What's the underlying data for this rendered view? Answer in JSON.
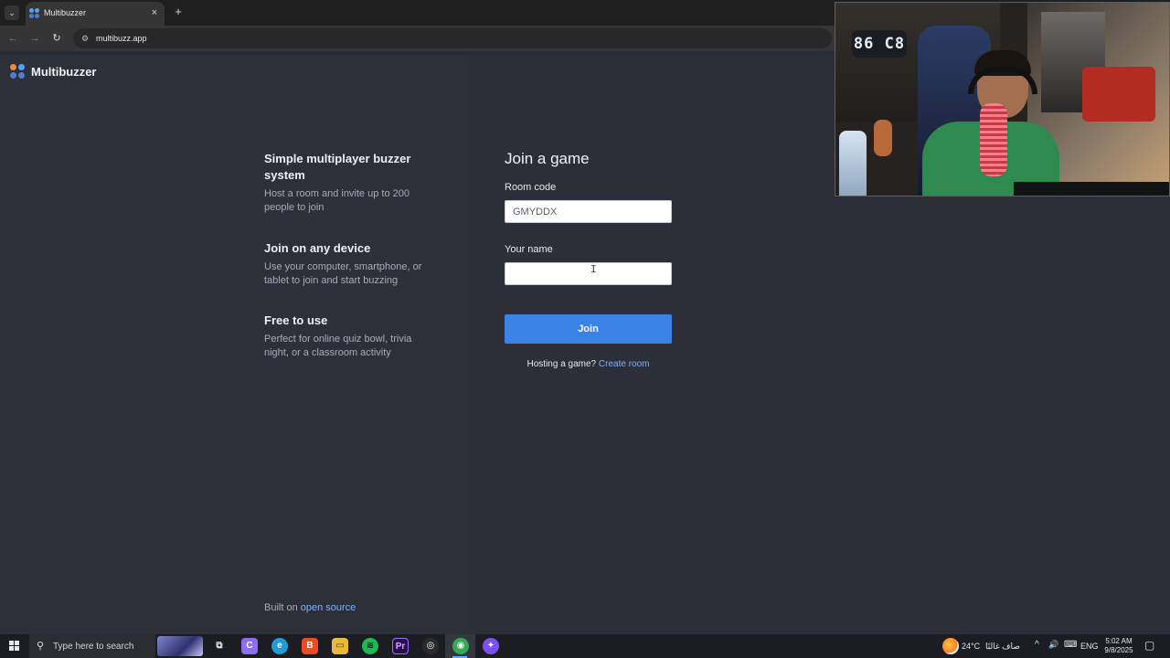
{
  "browser": {
    "tab_title": "Multibuzzer",
    "tab_close_label": "×",
    "new_tab_label": "+",
    "tab_list_label": "⌄",
    "url": "multibuzz.app",
    "back_label": "←",
    "forward_label": "→",
    "reload_label": "↻",
    "site_info_label": "⚙"
  },
  "brand": {
    "name": "Multibuzzer",
    "logo_colors": [
      "#f08c2e",
      "#5aa0f0",
      "#4c7dd9",
      "#4c7dd9"
    ]
  },
  "features": [
    {
      "title": "Simple multiplayer buzzer system",
      "description": "Host a room and invite up to 200 people to join"
    },
    {
      "title": "Join on any device",
      "description": "Use your computer, smartphone, or tablet to join and start buzzing"
    },
    {
      "title": "Free to use",
      "description": "Perfect for online quiz bowl, trivia night, or a classroom activity"
    }
  ],
  "footer": {
    "built_on_prefix": "Built on ",
    "built_on_link": "open source"
  },
  "join_form": {
    "title": "Join a game",
    "room_code_label": "Room code",
    "room_code_value": "GMYDDX",
    "name_label": "Your name",
    "name_value": "",
    "cursor_glyph": "I",
    "join_button": "Join",
    "hosting_prefix": "Hosting a game?",
    "create_room_link": "Create room"
  },
  "webcam": {
    "clock_display": "86 C8"
  },
  "taskbar": {
    "search_placeholder": "Type here to search",
    "search_icon_glyph": "⚲",
    "task_view_glyph": "⧉",
    "icons": [
      {
        "name": "copilot-icon",
        "glyph": "C",
        "color": "#8f6df0"
      },
      {
        "name": "edge-icon",
        "glyph": "e",
        "color": "#1f9bd8"
      },
      {
        "name": "brave-icon",
        "glyph": "B",
        "color": "#ef4b23"
      },
      {
        "name": "file-explorer-icon",
        "glyph": "▭",
        "color": "#e8b93a"
      },
      {
        "name": "spotify-icon",
        "glyph": "≋",
        "color": "#1db954"
      },
      {
        "name": "premiere-pro-icon",
        "glyph": "Pr",
        "color": "#2a0f4f"
      },
      {
        "name": "obs-icon",
        "glyph": "◎",
        "color": "#2b2b2b"
      },
      {
        "name": "chrome-icon",
        "glyph": "◉",
        "color": "#34a853"
      },
      {
        "name": "messenger-icon",
        "glyph": "✦",
        "color": "#7b4ff0"
      }
    ],
    "weather": "24°C",
    "weather_desc": "صاف غالبًا",
    "tray_chevron": "^",
    "volume_glyph": "🔊",
    "network_glyph": "⌨",
    "language": "ENG",
    "time": "5:02 AM",
    "date": "9/8/2025",
    "notification_glyph": "▢"
  }
}
